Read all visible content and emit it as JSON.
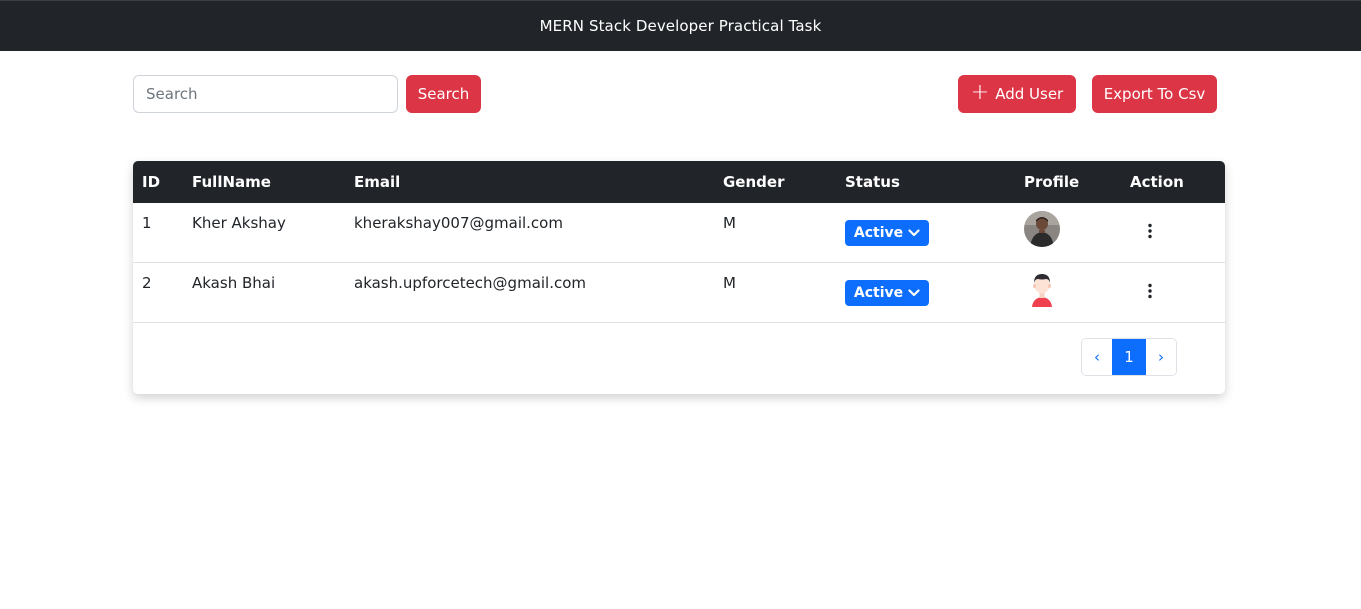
{
  "navbar": {
    "title": "MERN Stack Developer Practical Task"
  },
  "search": {
    "placeholder": "Search",
    "value": "",
    "button_label": "Search"
  },
  "actions": {
    "add_user_label": "Add User",
    "add_icon": "plus-icon",
    "export_label": "Export To Csv"
  },
  "colors": {
    "primary": "#0d6efd",
    "danger": "#dc3545",
    "dark": "#212529"
  },
  "table": {
    "headers": {
      "id": "ID",
      "fullname": "FullName",
      "email": "Email",
      "gender": "Gender",
      "status": "Status",
      "profile": "Profile",
      "action": "Action"
    },
    "rows": [
      {
        "id": "1",
        "fullname": "Kher Akshay",
        "email": "kherakshay007@gmail.com",
        "gender": "M",
        "status": "Active",
        "profile_icon": "user-photo-avatar"
      },
      {
        "id": "2",
        "fullname": "Akash Bhai",
        "email": "akash.upforcetech@gmail.com",
        "gender": "M",
        "status": "Active",
        "profile_icon": "cartoon-avatar"
      }
    ]
  },
  "pagination": {
    "prev": "‹",
    "current": "1",
    "next": "›"
  }
}
